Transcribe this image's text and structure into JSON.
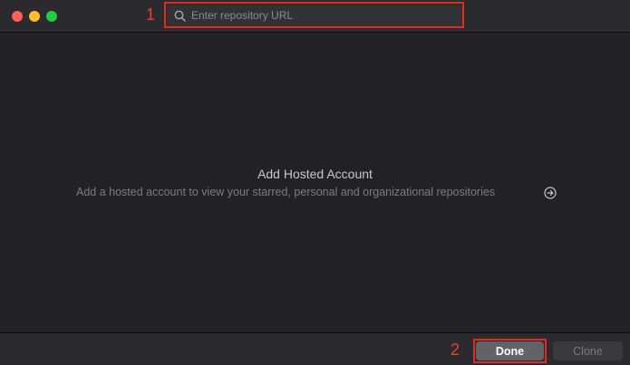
{
  "window": {
    "traffic_lights": {
      "close_color": "#ff5f57",
      "minimize_color": "#febc2e",
      "zoom_color": "#28c840"
    }
  },
  "search": {
    "placeholder": "Enter repository URL",
    "value": "",
    "icon": "magnifying-glass-icon"
  },
  "annotations": {
    "label_1": "1",
    "label_2": "2",
    "color": "#e32d1c"
  },
  "empty_state": {
    "title": "Add Hosted Account",
    "subtitle": "Add a hosted account to view your starred, personal and organizational repositories",
    "action_icon": "arrow-right-circle-icon"
  },
  "footer": {
    "done_label": "Done",
    "clone_label": "Clone"
  }
}
